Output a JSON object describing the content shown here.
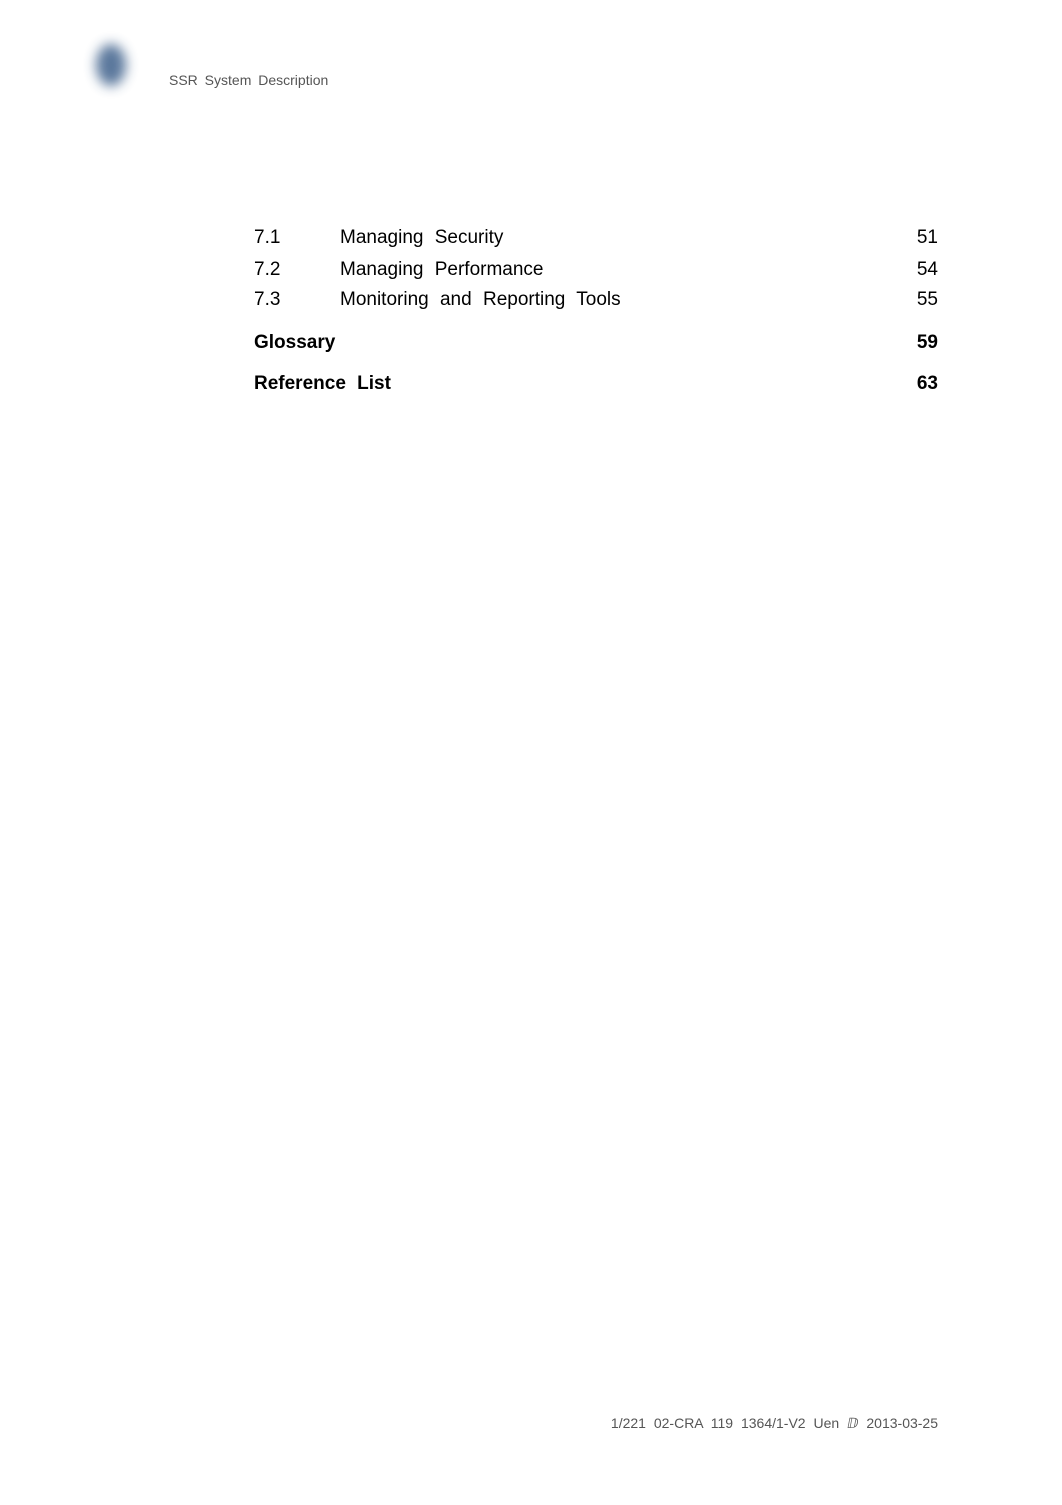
{
  "header": {
    "title": "SSR System Description"
  },
  "toc": {
    "entries": [
      {
        "number": "7.1",
        "title": "Managing Security",
        "page": "51",
        "bold": false
      },
      {
        "number": "7.2",
        "title": "Managing Performance",
        "page": "54",
        "bold": false
      },
      {
        "number": "7.3",
        "title": "Monitoring and Reporting Tools",
        "page": "55",
        "bold": false
      },
      {
        "number": "",
        "title": "Glossary",
        "page": "59",
        "bold": true
      },
      {
        "number": "",
        "title": "Reference List",
        "page": "63",
        "bold": true
      }
    ]
  },
  "footer": {
    "doc_id": "1/221 02-CRA 119 1364/1-V2 Uen ⅅ 2013-03-25"
  }
}
